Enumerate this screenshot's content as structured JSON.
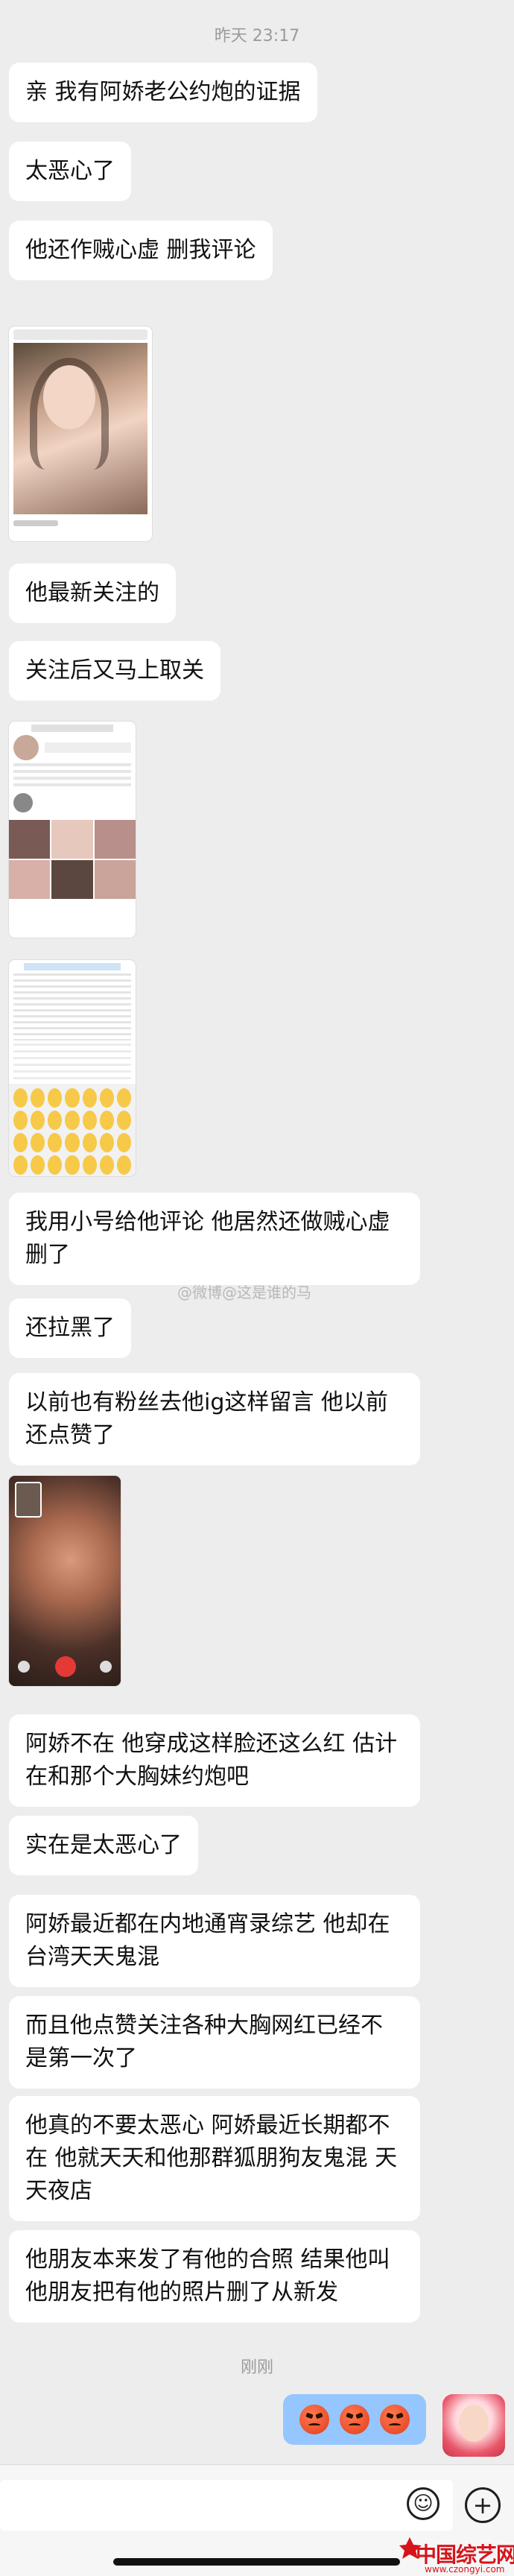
{
  "chat": {
    "timestamp_top": "昨天 23:17",
    "messages": [
      "亲 我有阿娇老公约炮的证据",
      "太恶心了",
      "他还作贼心虚 删我评论",
      "他最新关注的",
      "关注后又马上取关",
      "我用小号给他评论 他居然还做贼心虚删了",
      "还拉黑了",
      "以前也有粉丝去他ig这样留言 他以前还点赞了",
      "阿娇不在 他穿成这样脸还这么红 估计在和那个大胸妹约炮吧",
      "实在是太恶心了",
      "阿娇最近都在内地通宵录综艺 他却在台湾天天鬼混",
      "而且他点赞关注各种大胸网红已经不是第一次了",
      "他真的不要太恶心 阿娇最近长期都不在 他就天天和他那群狐朋狗友鬼混 天天夜店",
      "他朋友本来发了有他的合照 结果他叫他朋友把有他的照片删了从新发"
    ],
    "watermark": "@微博@这是谁的马",
    "timestamp_bottom": "刚刚",
    "reply_emojis": [
      "angry-face",
      "angry-face",
      "angry-face"
    ]
  },
  "input": {
    "placeholder": ""
  },
  "logo": {
    "text": "中国综艺网",
    "url_text": "www.czongyi.com"
  },
  "colors": {
    "background": "#ededed",
    "bubble_in": "#ffffff",
    "bubble_out": "#95c6ff",
    "logo_red": "#d6141b"
  }
}
